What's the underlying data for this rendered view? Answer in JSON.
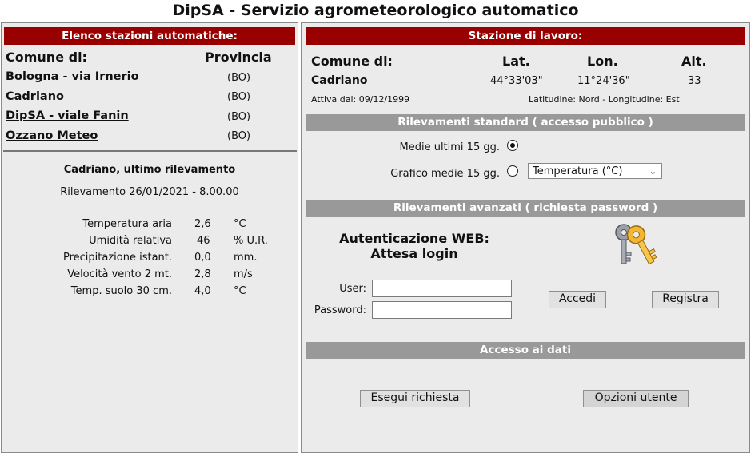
{
  "page_title": "DipSA - Servizio agrometeorologico automatico",
  "left": {
    "header": "Elenco stazioni automatiche:",
    "col_comune": "Comune di:",
    "col_provincia": "Provincia",
    "stations": [
      {
        "name": "Bologna - via Irnerio",
        "prov": "(BO)"
      },
      {
        "name": "Cadriano",
        "prov": "(BO)"
      },
      {
        "name": "DipSA - viale Fanin",
        "prov": "(BO)"
      },
      {
        "name": "Ozzano Meteo",
        "prov": "(BO)"
      }
    ],
    "last_title": "Cadriano, ultimo rilevamento",
    "last_time": "Rilevamento 26/01/2021 - 8.00.00",
    "readings": [
      {
        "label": "Temperatura aria",
        "value": "2,6",
        "unit": "°C"
      },
      {
        "label": "Umidità relativa",
        "value": "46",
        "unit": "% U.R."
      },
      {
        "label": "Precipitazione istant.",
        "value": "0,0",
        "unit": "mm."
      },
      {
        "label": "Velocità vento 2 mt.",
        "value": "2,8",
        "unit": "m/s"
      },
      {
        "label": "Temp. suolo 30 cm.",
        "value": "4,0",
        "unit": "°C"
      }
    ]
  },
  "right": {
    "header": "Stazione di lavoro:",
    "col_comune": "Comune di:",
    "col_lat": "Lat.",
    "col_lon": "Lon.",
    "col_alt": "Alt.",
    "station_name": "Cadriano",
    "lat": "44°33'03\"",
    "lon": "11°24'36\"",
    "alt": "33",
    "active_since": "Attiva dal: 09/12/1999",
    "coords_note": "Latitudine: Nord - Longitudine: Est",
    "standard_header": "Rilevamenti standard ( accesso pubblico )",
    "opt_medie": "Medie ultimi 15 gg.",
    "opt_grafico": "Grafico medie 15 gg.",
    "select_value": "Temperatura (°C)",
    "advanced_header": "Rilevamenti avanzati ( richiesta password )",
    "auth_line1": "Autenticazione WEB:",
    "auth_line2": "Attesa login",
    "user_label": "User:",
    "user_value": "",
    "password_label": "Password:",
    "password_value": "",
    "btn_accedi": "Accedi",
    "btn_registra": "Registra",
    "data_header": "Accesso ai dati",
    "btn_esegui": "Esegui richiesta",
    "btn_opzioni": "Opzioni utente"
  },
  "colors": {
    "red_bar": "#990000",
    "grey_bar": "#999999",
    "panel_bg": "#ebebeb"
  },
  "icons": {
    "keys": "keys-icon",
    "dropdown": "chevron-down-icon"
  }
}
